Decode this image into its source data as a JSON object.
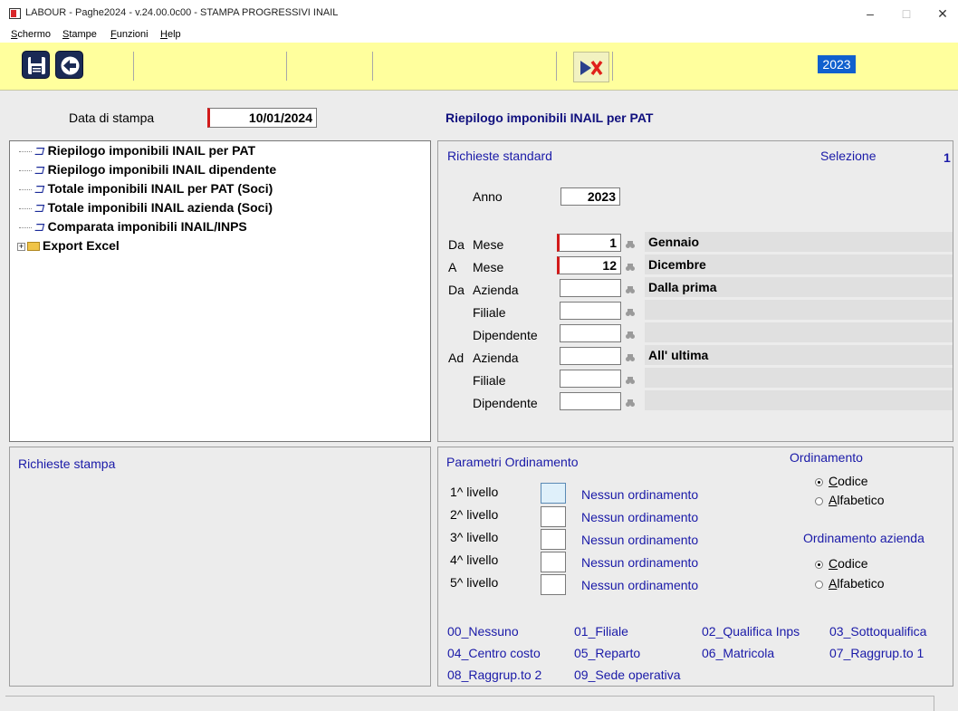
{
  "window": {
    "title": "LABOUR - Paghe2024 - v.24.00.0c00 - STAMPA PROGRESSIVI INAIL",
    "minimize": "–",
    "maximize": "□",
    "close": "✕"
  },
  "menu": [
    {
      "label": "Schermo",
      "accel": "S"
    },
    {
      "label": "Stampe",
      "accel": "S"
    },
    {
      "label": "Funzioni",
      "accel": "F"
    },
    {
      "label": "Help",
      "accel": "H"
    }
  ],
  "toolbar": {
    "save_icon": "save-icon",
    "back_icon": "back-arrow-icon",
    "print_icon": "print-arrow-cancel-icon",
    "year": "2023"
  },
  "header": {
    "print_date_label": "Data di stampa",
    "print_date_value": "10/01/2024",
    "report_title": "Riepilogo imponibili INAIL per PAT"
  },
  "tree": {
    "items": [
      {
        "label": "Riepilogo imponibili INAIL per PAT",
        "icon": "report-icon"
      },
      {
        "label": "Riepilogo imponibili INAIL dipendente",
        "icon": "report-icon"
      },
      {
        "label": "Totale imponibili INAIL per PAT (Soci)",
        "icon": "report-icon"
      },
      {
        "label": "Totale imponibili INAIL azienda (Soci)",
        "icon": "report-icon"
      },
      {
        "label": "Comparata imponibili INAIL/INPS",
        "icon": "report-icon"
      },
      {
        "label": "Export Excel",
        "icon": "folder-icon"
      }
    ]
  },
  "standard": {
    "heading": "Richieste standard",
    "selection_label": "Selezione",
    "selection_value": "1",
    "anno_label": "Anno",
    "anno_value": "2023",
    "rows": [
      {
        "prefix": "Da",
        "label": "Mese",
        "value": "1",
        "desc": "Gennaio"
      },
      {
        "prefix": "A",
        "label": "Mese",
        "value": "12",
        "desc": "Dicembre"
      },
      {
        "prefix": "Da",
        "label": "Azienda",
        "value": "",
        "desc": "Dalla prima"
      },
      {
        "prefix": "",
        "label": "Filiale",
        "value": "",
        "desc": ""
      },
      {
        "prefix": "",
        "label": "Dipendente",
        "value": "",
        "desc": ""
      },
      {
        "prefix": "Ad",
        "label": "Azienda",
        "value": "",
        "desc": "All' ultima"
      },
      {
        "prefix": "",
        "label": "Filiale",
        "value": "",
        "desc": ""
      },
      {
        "prefix": "",
        "label": "Dipendente",
        "value": "",
        "desc": ""
      }
    ]
  },
  "print_requests": {
    "heading": "Richieste stampa"
  },
  "ordering": {
    "heading": "Parametri Ordinamento",
    "levels": [
      {
        "label": "1^ livello",
        "value": "Nessun ordinamento"
      },
      {
        "label": "2^ livello",
        "value": "Nessun ordinamento"
      },
      {
        "label": "3^ livello",
        "value": "Nessun ordinamento"
      },
      {
        "label": "4^ livello",
        "value": "Nessun ordinamento"
      },
      {
        "label": "5^ livello",
        "value": "Nessun ordinamento"
      }
    ],
    "ordinamento_title": "Ordinamento",
    "ordinamento_options": [
      {
        "label": "Codice",
        "accel": "C",
        "selected": true
      },
      {
        "label": "Alfabetico",
        "accel": "A",
        "selected": false
      }
    ],
    "azienda_title": "Ordinamento azienda",
    "azienda_options": [
      {
        "label": "Codice",
        "accel": "C",
        "selected": true
      },
      {
        "label": "Alfabetico",
        "accel": "A",
        "selected": false
      }
    ],
    "legend": [
      "00_Nessuno",
      "01_Filiale",
      "02_Qualifica Inps",
      "03_Sottoqualifica",
      "04_Centro costo",
      "05_Reparto",
      "06_Matricola",
      "07_Raggrup.to 1",
      "08_Raggrup.to 2",
      "09_Sede operativa"
    ]
  }
}
